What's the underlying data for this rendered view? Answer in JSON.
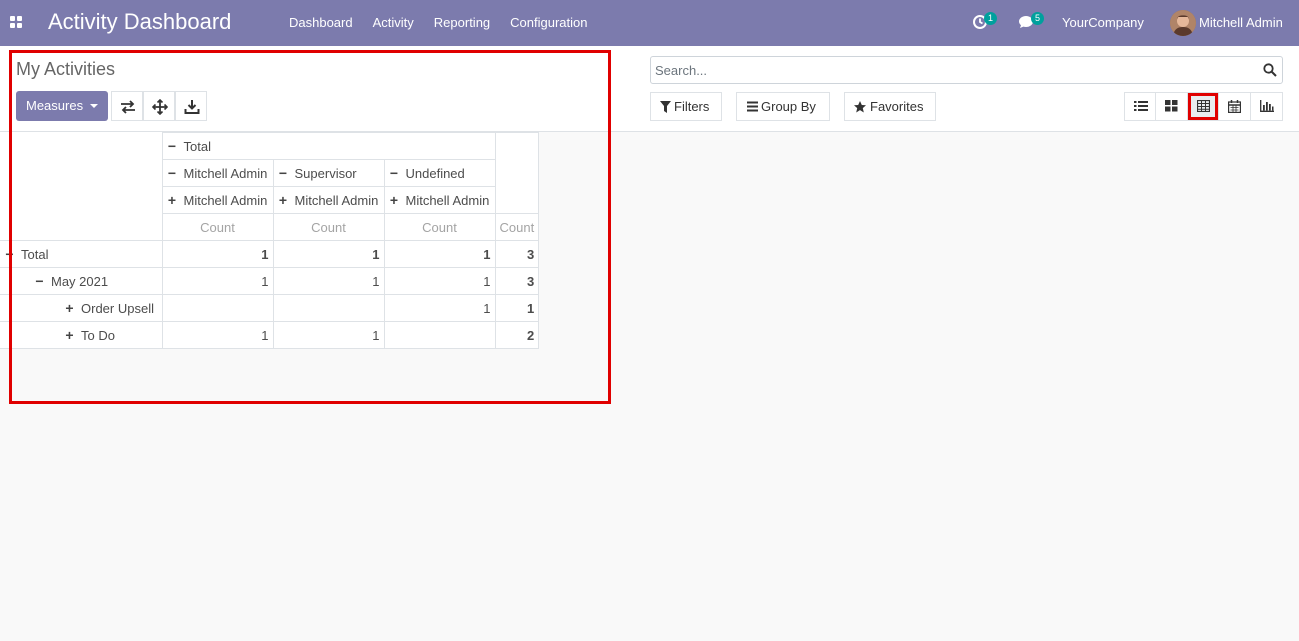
{
  "navbar": {
    "brand": "Activity Dashboard",
    "menu": [
      "Dashboard",
      "Activity",
      "Reporting",
      "Configuration"
    ],
    "activity_count": "1",
    "message_count": "5",
    "company": "YourCompany",
    "user": "Mitchell Admin",
    "bg_color": "#7c7bad"
  },
  "control_panel": {
    "title": "My Activities",
    "measures_label": "Measures",
    "search_placeholder": "Search...",
    "filters_label": "Filters",
    "group_by_label": "Group By",
    "favorites_label": "Favorites",
    "tool_icons": [
      "flip-axis-icon",
      "expand-all-icon",
      "download-icon"
    ],
    "views": [
      "list-view-icon",
      "kanban-view-icon",
      "pivot-view-icon",
      "calendar-view-icon",
      "graph-view-icon"
    ],
    "active_view": "pivot-view-icon"
  },
  "pivot": {
    "col_total": "Total",
    "col_groups": [
      "Mitchell Admin",
      "Supervisor",
      "Undefined"
    ],
    "col_subgroups": [
      "Mitchell Admin",
      "Mitchell Admin",
      "Mitchell Admin"
    ],
    "measure": "Count",
    "rows": [
      {
        "label": "Total",
        "values": [
          "1",
          "1",
          "1"
        ],
        "total": "3"
      },
      {
        "label": "May 2021",
        "values": [
          "1",
          "1",
          "1"
        ],
        "total": "3"
      },
      {
        "label": "Order Upsell",
        "values": [
          "",
          "",
          "1"
        ],
        "total": "1"
      },
      {
        "label": "To Do",
        "values": [
          "1",
          "1",
          ""
        ],
        "total": "2"
      }
    ]
  }
}
